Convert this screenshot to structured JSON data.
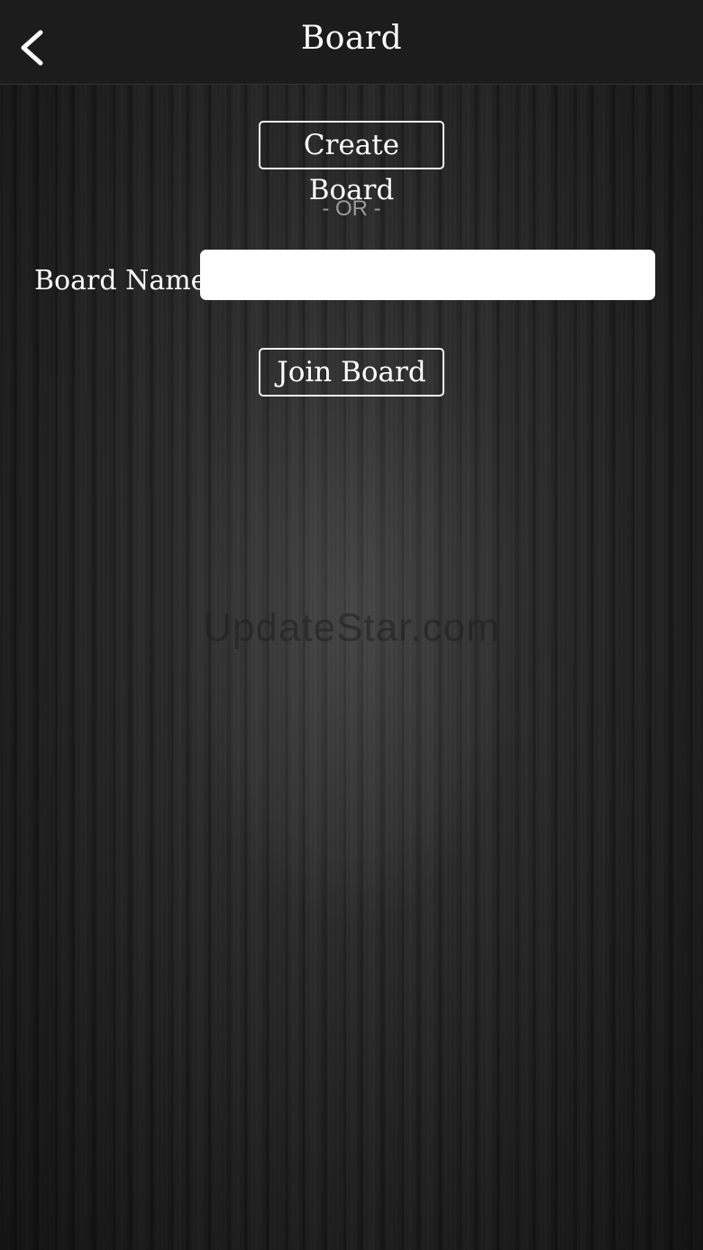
{
  "navbar": {
    "title": "Board",
    "back_icon": "chevron-left-icon"
  },
  "actions": {
    "create_label": "Create Board",
    "or_label": "- OR -",
    "join_label": "Join Board"
  },
  "form": {
    "board_name_label": "Board Name",
    "board_name_value": "",
    "board_name_placeholder": ""
  },
  "watermark": {
    "text": "UpdateStar.com"
  },
  "colors": {
    "navbar_bg": "#1c1c1c",
    "text": "#ffffff",
    "or_text": "#9a9a9a",
    "input_bg": "#ffffff"
  }
}
